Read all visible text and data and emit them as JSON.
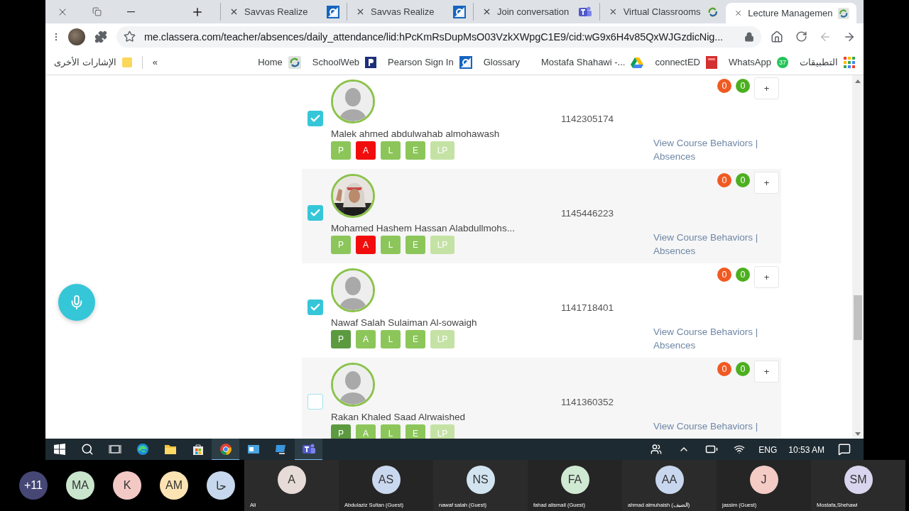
{
  "browser": {
    "tabs": [
      {
        "title": "Savvas Realize",
        "selected": false
      },
      {
        "title": "Savvas Realize",
        "selected": false
      },
      {
        "title": "Join conversation",
        "selected": false
      },
      {
        "title": "Virtual Classrooms",
        "selected": false
      },
      {
        "title": "Lecture Managemen",
        "selected": true
      }
    ],
    "url": "me.classera.com/teacher/absences/daily_attendance/lid:hPcKmRsDupMsO03VzkXWpgC1E9/cid:wG9x6H4v85QxWJGzdicNig...",
    "bookmarks_other": "الإشارات الأخرى",
    "bookmarks_more": "«",
    "bookmarks": [
      {
        "label": "Home"
      },
      {
        "label": "SchoolWeb"
      },
      {
        "label": "Pearson Sign In"
      },
      {
        "label": "Glossary"
      },
      {
        "label": "Mostafa Shahawi -..."
      },
      {
        "label": "connectED"
      },
      {
        "label": "WhatsApp",
        "badge": "37"
      },
      {
        "label": "التطبيقات"
      }
    ]
  },
  "students": [
    {
      "name": "Malek ahmed abdulwahab almohawash",
      "id": "1142305174",
      "checked": true,
      "kind": "default",
      "counts": [
        "0",
        "0"
      ],
      "add": "+",
      "link": "View Course Behaviors |",
      "link2": "Absences",
      "statuses": [
        {
          "label": "P",
          "selected": false,
          "disabled": false
        },
        {
          "label": "A",
          "selected": true,
          "disabled": false
        },
        {
          "label": "L",
          "selected": false,
          "disabled": false
        },
        {
          "label": "E",
          "selected": false,
          "disabled": false
        },
        {
          "label": "LP",
          "selected": false,
          "disabled": true
        }
      ]
    },
    {
      "name": "Mohamed Hashem Hassan Alabdullmohs...",
      "id": "1145446223",
      "checked": true,
      "counts": [
        "0",
        "0"
      ],
      "add": "+",
      "link": "View Course Behaviors |",
      "link2": "Absences",
      "statuses": [
        {
          "label": "P",
          "selected": false,
          "disabled": false
        },
        {
          "label": "A",
          "selected": true,
          "disabled": false
        },
        {
          "label": "L",
          "selected": false,
          "disabled": false
        },
        {
          "label": "E",
          "selected": false,
          "disabled": false
        },
        {
          "label": "LP",
          "selected": false,
          "disabled": true
        }
      ]
    },
    {
      "name": "Nawaf Salah Sulaiman Al-sowaigh",
      "id": "1141718401",
      "checked": true,
      "kind": "default",
      "counts": [
        "0",
        "0"
      ],
      "add": "+",
      "link": "View Course Behaviors |",
      "link2": "Absences",
      "statuses": [
        {
          "label": "P",
          "selected": true,
          "disabled": false
        },
        {
          "label": "A",
          "selected": false,
          "disabled": false
        },
        {
          "label": "L",
          "selected": false,
          "disabled": false
        },
        {
          "label": "E",
          "selected": false,
          "disabled": false
        },
        {
          "label": "LP",
          "selected": false,
          "disabled": true
        }
      ]
    },
    {
      "name": "Rakan Khaled Saad Alrwaished",
      "id": "1141360352",
      "checked": false,
      "kind": "default",
      "counts": [
        "0",
        "0"
      ],
      "add": "+",
      "link": "View Course Behaviors |",
      "statuses": [
        {
          "label": "P",
          "selected": true,
          "disabled": false
        },
        {
          "label": "A",
          "selected": false,
          "disabled": false
        },
        {
          "label": "L",
          "selected": false,
          "disabled": false
        },
        {
          "label": "E",
          "selected": false,
          "disabled": false
        },
        {
          "label": "LP",
          "selected": false,
          "disabled": true
        }
      ]
    }
  ],
  "taskbar": {
    "apps": [
      {
        "active": false
      },
      {
        "active": false
      },
      {
        "active": false
      },
      {
        "active": true
      },
      {
        "active": false
      },
      {
        "active": false
      },
      {
        "active": true
      }
    ],
    "language": "ENG",
    "time": "10:53 AM"
  },
  "participants": [
    {
      "initials": "+11",
      "kind": "compact",
      "color": "#464775"
    },
    {
      "initials": "MA",
      "kind": "compact",
      "color": "#c9e6cd"
    },
    {
      "initials": "K",
      "kind": "compact",
      "color": "#f3c9c6"
    },
    {
      "initials": "AM",
      "kind": "compact",
      "color": "#fbe3b3"
    },
    {
      "initials": "حا",
      "kind": "compact",
      "color": "#c7d8ee"
    },
    {
      "initials": "A",
      "kind": "tile",
      "name": "Ali",
      "color": "#e6dbd6"
    },
    {
      "initials": "AS",
      "kind": "tile",
      "name": "Abdulaziz Sultan (Guest)",
      "color": "#cad8ef"
    },
    {
      "initials": "NS",
      "kind": "tile",
      "name": "nawaf salah (Guest)",
      "color": "#d2e4ef"
    },
    {
      "initials": "FA",
      "kind": "tile",
      "name": "fahad alismail (Guest)",
      "color": "#cfe9d2"
    },
    {
      "initials": "AA",
      "kind": "tile",
      "name": "ahmad almuhaish (الضيف)",
      "color": "#c9d7ee"
    },
    {
      "initials": "J",
      "kind": "tile",
      "name": "jassim (Guest)",
      "color": "#f5cbc6"
    },
    {
      "initials": "SM",
      "kind": "tile",
      "name": "Mostafa,Shehawi",
      "color": "#d9d5ee"
    }
  ]
}
